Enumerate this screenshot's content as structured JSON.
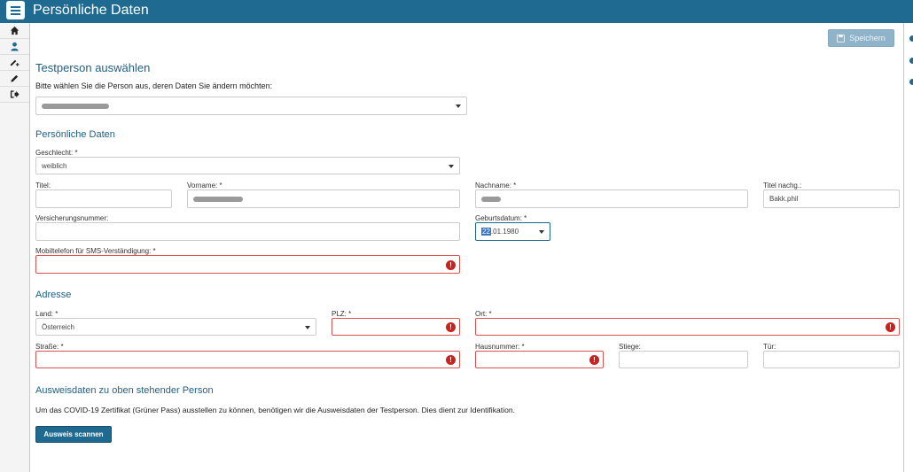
{
  "app": {
    "title": "Persönliche Daten"
  },
  "sidebar": {
    "items": [
      {
        "icon": "home-icon"
      },
      {
        "icon": "user-icon"
      },
      {
        "icon": "user-edit-icon"
      },
      {
        "icon": "pencil-icon"
      },
      {
        "icon": "logout-icon"
      }
    ]
  },
  "toolbar": {
    "save_label": "Speichern"
  },
  "testperson": {
    "heading": "Testperson auswählen",
    "instruction": "Bitte wählen Sie die Person aus, deren Daten Sie ändern möchten:"
  },
  "personal": {
    "heading": "Persönliche Daten",
    "gender_label": "Geschlecht: *",
    "gender_value": "weiblich",
    "title_label": "Titel:",
    "title_value": "",
    "firstname_label": "Vorname: *",
    "lastname_label": "Nachname: *",
    "title_after_label": "Titel nachg.:",
    "title_after_value": "Bakk.phil",
    "insurance_label": "Versicherungsnummer:",
    "insurance_value": "",
    "birthdate_label": "Geburtsdatum: *",
    "birthdate_selected": "22",
    "birthdate_rest": ".01.1980",
    "mobile_label": "Mobiltelefon für SMS-Verständigung: *",
    "mobile_value": ""
  },
  "address": {
    "heading": "Adresse",
    "country_label": "Land: *",
    "country_value": "Österreich",
    "zip_label": "PLZ: *",
    "city_label": "Ort: *",
    "street_label": "Straße: *",
    "house_label": "Hausnummer: *",
    "stair_label": "Stiege:",
    "door_label": "Tür:"
  },
  "id_section": {
    "heading": "Ausweisdaten zu oben stehender Person",
    "description": "Um das COVID-19 Zertifikat (Grüner Pass) ausstellen zu können, benötigen wir die Ausweisdaten der Testperson. Dies dient zur Identifikation.",
    "scan_label": "Ausweis scannen"
  },
  "error_glyph": "!",
  "colors": {
    "brand": "#1f6a91",
    "error": "#c9211e",
    "save_disabled": "#8fb3c9"
  }
}
